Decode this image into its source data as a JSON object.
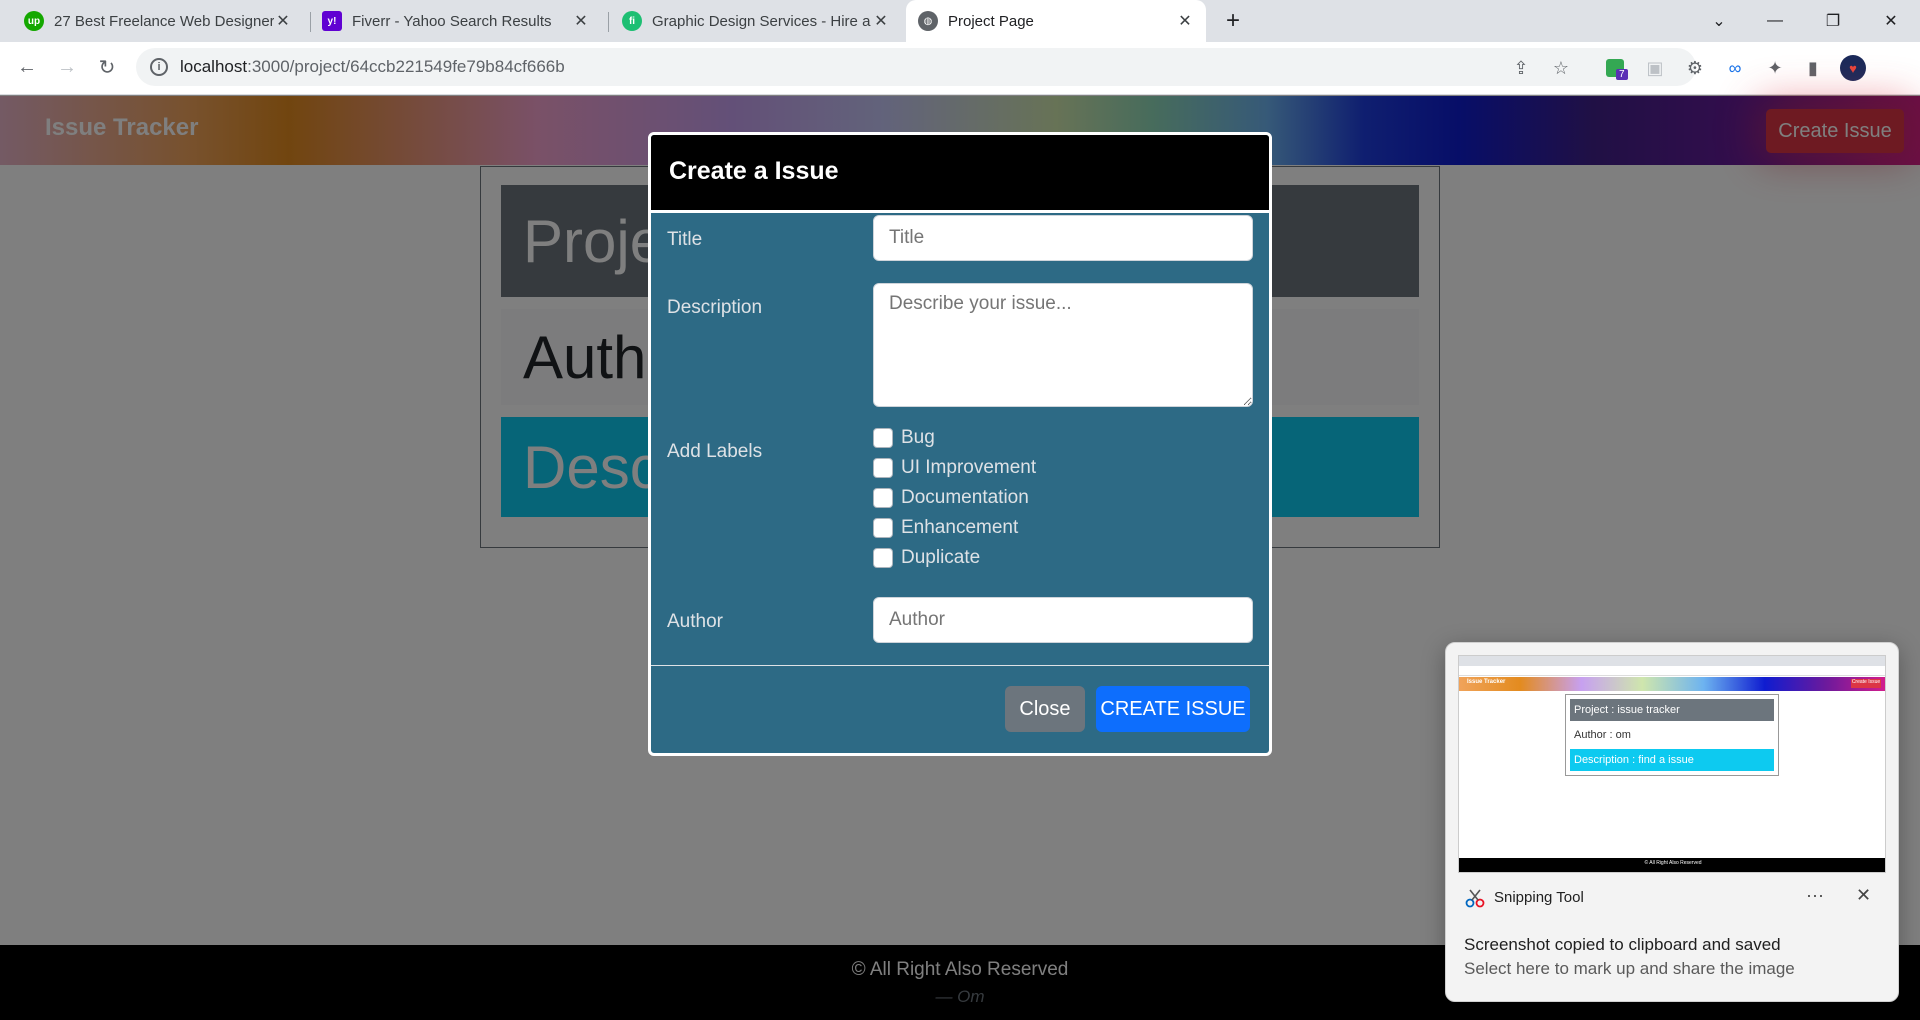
{
  "browser": {
    "tabs": [
      {
        "title": "27 Best Freelance Web Designers",
        "favicon": "upwork-icon",
        "favicon_color": "#14a800",
        "favicon_text": "up"
      },
      {
        "title": "Fiverr - Yahoo Search Results",
        "favicon": "yahoo-icon",
        "favicon_color": "#6001d2",
        "favicon_text": "y!"
      },
      {
        "title": "Graphic Design Services - Hire a",
        "favicon": "fiverr-icon",
        "favicon_color": "#1dbf73",
        "favicon_text": "fi"
      },
      {
        "title": "Project Page",
        "favicon": "globe-icon",
        "active": true
      }
    ],
    "url_host": "localhost",
    "url_path": ":3000/project/64ccb221549fe79b84cf666b",
    "extension_badge": "7"
  },
  "app": {
    "brand": "Issue Tracker",
    "create_issue_button": "Create Issue",
    "project_row": "Project : issue tracker",
    "author_row": "Author : om",
    "description_row": "Description : find a issue",
    "footer_copyright": "© All Right Also Reserved",
    "footer_author": "— Om"
  },
  "modal": {
    "title": "Create a Issue",
    "title_label": "Title",
    "title_placeholder": "Title",
    "description_label": "Description",
    "description_placeholder": "Describe your issue...",
    "labels_label": "Add Labels",
    "label_options": [
      "Bug",
      "UI Improvement",
      "Documentation",
      "Enhancement",
      "Duplicate"
    ],
    "author_label": "Author",
    "author_placeholder": "Author",
    "close_button": "Close",
    "submit_button": "CREATE ISSUE"
  },
  "toast": {
    "app_name": "Snipping Tool",
    "line1": "Screenshot copied to clipboard and saved",
    "line2": "Select here to mark up and share the image",
    "more": "···",
    "thumb_brand": "Issue Tracker",
    "thumb_button": "Create Issue",
    "thumb_project": "Project : issue tracker",
    "thumb_author": "Author : om",
    "thumb_description": "Description : find a issue",
    "thumb_footer": "© All Right Also Reserved"
  },
  "colors": {
    "danger": "#dc3545",
    "primary": "#0d6efd",
    "secondary": "#6c757d",
    "info": "#0dcaf0",
    "modal_body": "#2d6a85"
  }
}
